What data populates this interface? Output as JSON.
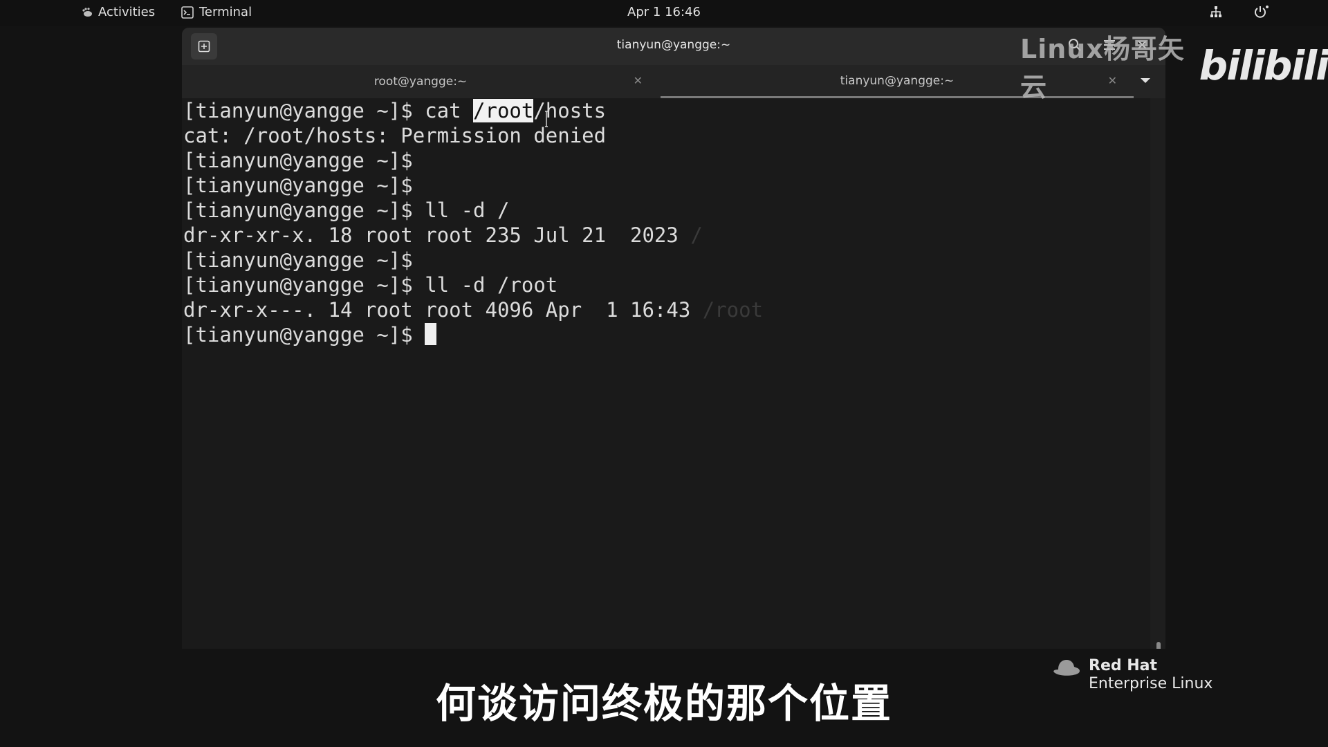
{
  "topbar": {
    "activities_label": "Activities",
    "app_label": "Terminal",
    "clock": "Apr 1  16:46"
  },
  "window": {
    "title": "tianyun@yangge:~"
  },
  "tabs": [
    {
      "label": "root@yangge:~",
      "active": false
    },
    {
      "label": "tianyun@yangge:~",
      "active": true
    }
  ],
  "terminal": {
    "lines": [
      {
        "pre": "[tianyun@yangge ~]$ cat ",
        "selected": "/root",
        "post": "/hosts"
      },
      {
        "text": "cat: /root/hosts: Permission denied"
      },
      {
        "text": "[tianyun@yangge ~]$"
      },
      {
        "text": "[tianyun@yangge ~]$"
      },
      {
        "text": "[tianyun@yangge ~]$ ll -d /"
      },
      {
        "text": "dr-xr-xr-x. 18 root root 235 Jul 21  2023 ",
        "dim": "/"
      },
      {
        "text": "[tianyun@yangge ~]$"
      },
      {
        "text": "[tianyun@yangge ~]$ ll -d /root"
      },
      {
        "text": "dr-xr-x---. 14 root root 4096 Apr  1 16:43 ",
        "dim": "/root"
      },
      {
        "text": "[tianyun@yangge ~]$ "
      }
    ]
  },
  "watermark": {
    "text": "Linux杨哥矢云",
    "logo": "bilibili"
  },
  "os_branding": {
    "brand": "Red Hat",
    "product": "Enterprise Linux"
  },
  "subtitle": "何谈访问终极的那个位置",
  "colors": {
    "terminal_bg": "#1a1a1a",
    "terminal_fg": "#dcdcdc",
    "selection_bg": "#f2f2f2"
  }
}
